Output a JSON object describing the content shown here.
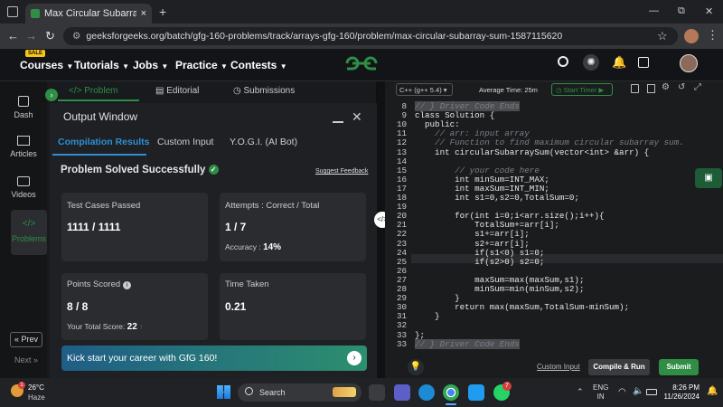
{
  "browser": {
    "tab_title": "Max Circular Subarray Sum | Pr...",
    "tab_close": "×",
    "new_tab": "+",
    "url": "geeksforgeeks.org/batch/gfg-160-problems/track/arrays-gfg-160/problem/max-circular-subarray-sum-1587115620",
    "window_controls": [
      "—",
      "⧉",
      "✕"
    ]
  },
  "site_nav": {
    "sale_badge": "SALE",
    "items": [
      "Courses",
      "Tutorials",
      "Jobs",
      "Practice",
      "Contests"
    ],
    "logo": "GfG"
  },
  "left_rail": {
    "items": [
      "Dash",
      "Articles",
      "Videos",
      "Problems"
    ],
    "prev": "Prev",
    "next": "Next"
  },
  "panel_tabs": {
    "problem": "Problem",
    "editorial": "Editorial",
    "submissions": "Submissions"
  },
  "output_window": {
    "title": "Output Window",
    "tabs": [
      "Compilation Results",
      "Custom Input",
      "Y.O.G.I. (AI Bot)"
    ],
    "status": "Problem Solved Successfully",
    "suggest_feedback": "Suggest Feedback",
    "test_cases_label": "Test Cases Passed",
    "test_cases_value": "1111 / 1111",
    "attempts_label": "Attempts : Correct / Total",
    "attempts_value": "1 / 7",
    "accuracy_label": "Accuracy :",
    "accuracy_value": "14%",
    "points_label": "Points Scored",
    "points_value": "8 / 8",
    "total_score_label": "Your Total Score:",
    "total_score_value": "22",
    "time_label": "Time Taken",
    "time_value": "0.21",
    "banner": "Kick start your career with GfG 160!"
  },
  "editor": {
    "language": "C++ (g++ 5.4)",
    "avg_time_label": "Average Time:",
    "avg_time_value": "25m",
    "start_timer": "Start Timer",
    "custom_input": "Custom Input",
    "compile_run": "Compile & Run",
    "submit": "Submit",
    "lines": [
      {
        "n": "8",
        "t": "// } Driver Code Ends"
      },
      {
        "n": "9",
        "t": "class Solution {"
      },
      {
        "n": "10",
        "t": "  public:"
      },
      {
        "n": "11",
        "t": "    // arr: input array"
      },
      {
        "n": "12",
        "t": "    // Function to find maximum circular subarray sum."
      },
      {
        "n": "13",
        "t": "    int circularSubarraySum(vector<int> &arr) {"
      },
      {
        "n": "14",
        "t": ""
      },
      {
        "n": "15",
        "t": "        // your code here"
      },
      {
        "n": "16",
        "t": "        int minSum=INT_MAX;"
      },
      {
        "n": "17",
        "t": "        int maxSum=INT_MIN;"
      },
      {
        "n": "18",
        "t": "        int s1=0,s2=0,TotalSum=0;"
      },
      {
        "n": "19",
        "t": ""
      },
      {
        "n": "20",
        "t": "        for(int i=0;i<arr.size();i++){"
      },
      {
        "n": "21",
        "t": "            TotalSum+=arr[i];"
      },
      {
        "n": "22",
        "t": "            s1+=arr[i];"
      },
      {
        "n": "23",
        "t": "            s2+=arr[i];"
      },
      {
        "n": "24",
        "t": "            if(s1<0) s1=0;"
      },
      {
        "n": "25",
        "t": "            if(s2>0) s2=0;"
      },
      {
        "n": "26",
        "t": ""
      },
      {
        "n": "27",
        "t": "            maxSum=max(maxSum,s1);"
      },
      {
        "n": "28",
        "t": "            minSum=min(minSum,s2);"
      },
      {
        "n": "29",
        "t": "        }"
      },
      {
        "n": "30",
        "t": "        return max(maxSum,TotalSum-minSum);"
      },
      {
        "n": "31",
        "t": "    }"
      },
      {
        "n": "32",
        "t": ""
      },
      {
        "n": "33",
        "t": "};"
      },
      {
        "n": "33",
        "t": "// } Driver Code Ends"
      }
    ]
  },
  "taskbar": {
    "temp": "26°C",
    "weather": "Haze",
    "search": "Search",
    "lang": "ENG",
    "region": "IN",
    "time": "8:26 PM",
    "date": "11/26/2024",
    "whatsapp_badge": "7",
    "weather_badge": "1"
  }
}
